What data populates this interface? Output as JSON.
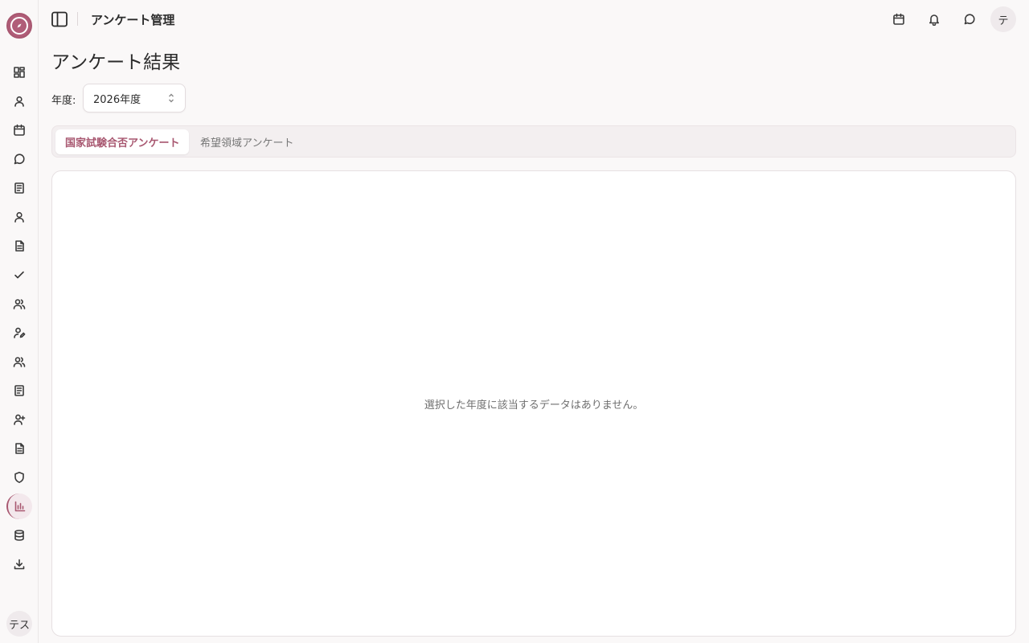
{
  "header": {
    "title": "アンケート管理",
    "avatar_initial": "テ"
  },
  "sidebar": {
    "avatar_label": "テス",
    "items": [
      {
        "icon": "dashboard-icon"
      },
      {
        "icon": "user-icon"
      },
      {
        "icon": "calendar-icon"
      },
      {
        "icon": "chat-icon"
      },
      {
        "icon": "notebook-icon"
      },
      {
        "icon": "user-icon"
      },
      {
        "icon": "file-text-icon"
      },
      {
        "icon": "check-icon"
      },
      {
        "icon": "users-icon"
      },
      {
        "icon": "user-pen-icon"
      },
      {
        "icon": "users-icon"
      },
      {
        "icon": "notebook-icon"
      },
      {
        "icon": "user-plus-icon"
      },
      {
        "icon": "file-text-icon"
      },
      {
        "icon": "shield-icon"
      },
      {
        "icon": "bar-chart-icon",
        "active": true
      },
      {
        "icon": "database-icon"
      },
      {
        "icon": "download-icon"
      }
    ]
  },
  "main": {
    "page_title": "アンケート結果",
    "year_label": "年度:",
    "year_value": "2026年度",
    "tabs": [
      {
        "label": "国家試験合否アンケート",
        "active": true
      },
      {
        "label": "希望領域アンケート",
        "active": false
      }
    ],
    "empty_message": "選択した年度に該当するデータはありません。"
  },
  "colors": {
    "accent": "#a85770",
    "background": "#faf8f8"
  }
}
